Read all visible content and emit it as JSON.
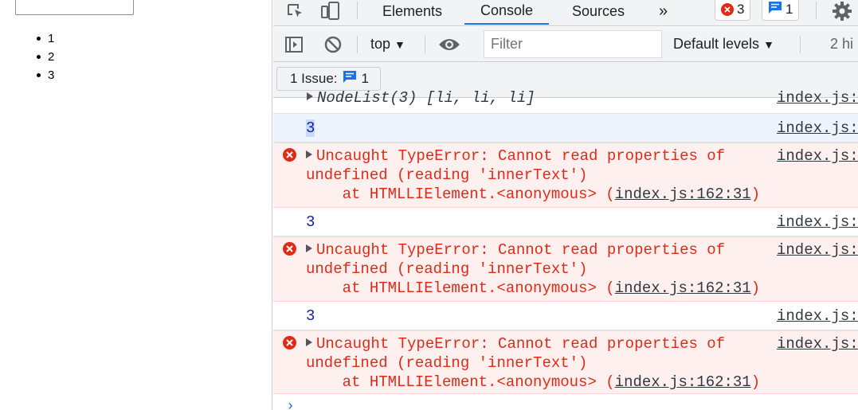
{
  "page": {
    "list_items": [
      "1",
      "2",
      "3"
    ]
  },
  "devtools": {
    "tabs": [
      "Elements",
      "Console",
      "Sources",
      "»"
    ],
    "error_count": "3",
    "message_count": "1",
    "toolbar": {
      "context": "top",
      "filter_placeholder": "Filter",
      "levels": "Default levels",
      "hidden_count": "2 hi"
    },
    "issues_label": "1 Issue:",
    "issues_count": "1",
    "colors": {
      "accent": "#1a73e8",
      "error": "#e12a16",
      "error_bg": "#fff0f0",
      "number": "#1a1aa6"
    }
  },
  "console": {
    "top_partial": {
      "text": "NodeList(3) [li, li, li]",
      "source": "index.js:"
    },
    "messages": [
      {
        "type": "log",
        "value": "3",
        "source": "index.js:"
      },
      {
        "type": "error",
        "line1": "Uncaught TypeError: Cannot read properties of",
        "line2": "undefined (reading 'innerText')",
        "line3_prefix": "    at HTMLLIElement.<anonymous> (",
        "line3_link": "index.js:162:31",
        "line3_suffix": ")",
        "source": "index.js:"
      },
      {
        "type": "log",
        "value": "3",
        "source": "index.js:"
      },
      {
        "type": "error",
        "line1": "Uncaught TypeError: Cannot read properties of",
        "line2": "undefined (reading 'innerText')",
        "line3_prefix": "    at HTMLLIElement.<anonymous> (",
        "line3_link": "index.js:162:31",
        "line3_suffix": ")",
        "source": "index.js:"
      },
      {
        "type": "log",
        "value": "3",
        "source": "index.js:"
      },
      {
        "type": "error",
        "line1": "Uncaught TypeError: Cannot read properties of",
        "line2": "undefined (reading 'innerText')",
        "line3_prefix": "    at HTMLLIElement.<anonymous> (",
        "line3_link": "index.js:162:31",
        "line3_suffix": ")",
        "source": "index.js:"
      }
    ],
    "prompt": "›"
  }
}
